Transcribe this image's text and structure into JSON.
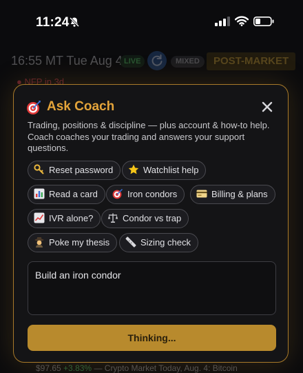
{
  "status_bar": {
    "time": "11:24"
  },
  "background": {
    "clock": "16:55 MT Tue Aug 4",
    "live_badge": "LIVE",
    "mixed_badge": "MIXED",
    "market_state": "POST-MARKET",
    "alert": "NFP in 3d",
    "footer_price": "$97.65",
    "footer_change": "+3.83%",
    "footer_headline": "— Crypto Market Today, Aug. 4: Bitcoin"
  },
  "modal": {
    "title": "Ask Coach",
    "description": "Trading, positions & discipline — plus account & how-to help. Coach coaches your trading and answers your support questions.",
    "chips": [
      {
        "icon": "key-icon",
        "label": "Reset password"
      },
      {
        "icon": "star-icon",
        "label": "Watchlist help"
      },
      {
        "icon": "bar-chart-icon",
        "label": "Read a card"
      },
      {
        "icon": "dart-icon",
        "label": "Iron condors"
      },
      {
        "icon": "credit-card-icon",
        "label": "Billing & plans"
      },
      {
        "icon": "trend-chart-icon",
        "label": "IVR alone?"
      },
      {
        "icon": "scales-icon",
        "label": "Condor vs trap"
      },
      {
        "icon": "detective-icon",
        "label": "Poke my thesis"
      },
      {
        "icon": "ruler-icon",
        "label": "Sizing check"
      }
    ],
    "input_value": "Build an iron condor",
    "submit_label": "Thinking..."
  },
  "colors": {
    "accent": "#e4a43a",
    "button": "#b88a2d",
    "border": "#a97a2a"
  }
}
